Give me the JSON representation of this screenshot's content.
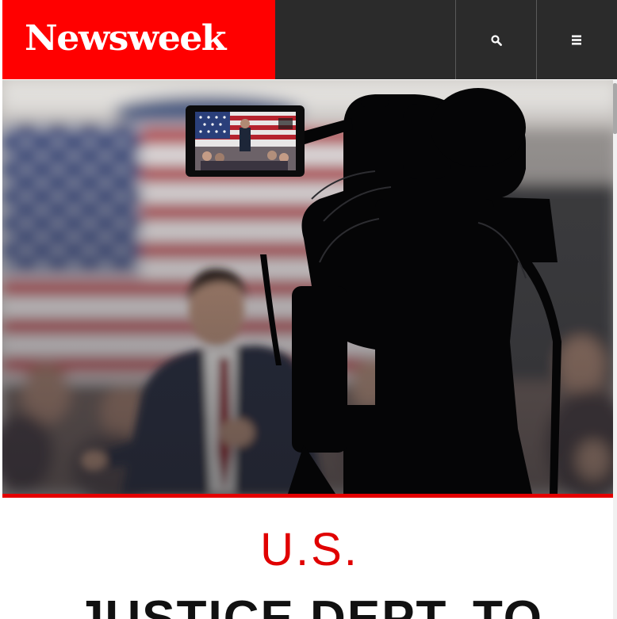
{
  "header": {
    "logo_text": "Newsweek",
    "search_icon": "search-icon",
    "menu_icon": "hamburger-menu-icon"
  },
  "hero": {
    "image": "press-camera-filming-speaker-with-american-flag"
  },
  "article": {
    "section_label": "U.S.",
    "headline": "JUSTICE DEPT. TO"
  },
  "colors": {
    "brand_red": "#ff0000",
    "header_dark": "#2b2b2b",
    "section_red": "#e00000",
    "rule_red": "#e40000",
    "headline": "#111111"
  }
}
